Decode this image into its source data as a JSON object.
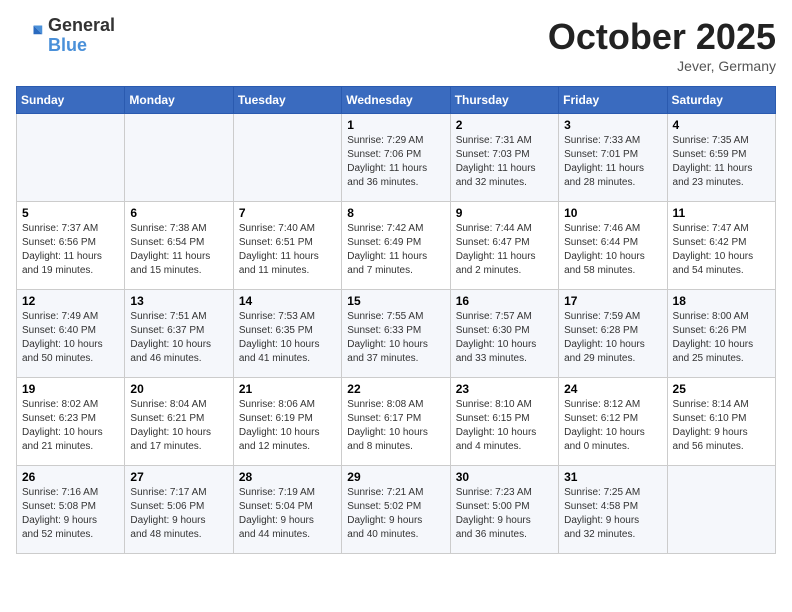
{
  "header": {
    "logo_line1": "General",
    "logo_line2": "Blue",
    "month": "October 2025",
    "location": "Jever, Germany"
  },
  "weekdays": [
    "Sunday",
    "Monday",
    "Tuesday",
    "Wednesday",
    "Thursday",
    "Friday",
    "Saturday"
  ],
  "weeks": [
    [
      {
        "day": "",
        "info": ""
      },
      {
        "day": "",
        "info": ""
      },
      {
        "day": "",
        "info": ""
      },
      {
        "day": "1",
        "info": "Sunrise: 7:29 AM\nSunset: 7:06 PM\nDaylight: 11 hours\nand 36 minutes."
      },
      {
        "day": "2",
        "info": "Sunrise: 7:31 AM\nSunset: 7:03 PM\nDaylight: 11 hours\nand 32 minutes."
      },
      {
        "day": "3",
        "info": "Sunrise: 7:33 AM\nSunset: 7:01 PM\nDaylight: 11 hours\nand 28 minutes."
      },
      {
        "day": "4",
        "info": "Sunrise: 7:35 AM\nSunset: 6:59 PM\nDaylight: 11 hours\nand 23 minutes."
      }
    ],
    [
      {
        "day": "5",
        "info": "Sunrise: 7:37 AM\nSunset: 6:56 PM\nDaylight: 11 hours\nand 19 minutes."
      },
      {
        "day": "6",
        "info": "Sunrise: 7:38 AM\nSunset: 6:54 PM\nDaylight: 11 hours\nand 15 minutes."
      },
      {
        "day": "7",
        "info": "Sunrise: 7:40 AM\nSunset: 6:51 PM\nDaylight: 11 hours\nand 11 minutes."
      },
      {
        "day": "8",
        "info": "Sunrise: 7:42 AM\nSunset: 6:49 PM\nDaylight: 11 hours\nand 7 minutes."
      },
      {
        "day": "9",
        "info": "Sunrise: 7:44 AM\nSunset: 6:47 PM\nDaylight: 11 hours\nand 2 minutes."
      },
      {
        "day": "10",
        "info": "Sunrise: 7:46 AM\nSunset: 6:44 PM\nDaylight: 10 hours\nand 58 minutes."
      },
      {
        "day": "11",
        "info": "Sunrise: 7:47 AM\nSunset: 6:42 PM\nDaylight: 10 hours\nand 54 minutes."
      }
    ],
    [
      {
        "day": "12",
        "info": "Sunrise: 7:49 AM\nSunset: 6:40 PM\nDaylight: 10 hours\nand 50 minutes."
      },
      {
        "day": "13",
        "info": "Sunrise: 7:51 AM\nSunset: 6:37 PM\nDaylight: 10 hours\nand 46 minutes."
      },
      {
        "day": "14",
        "info": "Sunrise: 7:53 AM\nSunset: 6:35 PM\nDaylight: 10 hours\nand 41 minutes."
      },
      {
        "day": "15",
        "info": "Sunrise: 7:55 AM\nSunset: 6:33 PM\nDaylight: 10 hours\nand 37 minutes."
      },
      {
        "day": "16",
        "info": "Sunrise: 7:57 AM\nSunset: 6:30 PM\nDaylight: 10 hours\nand 33 minutes."
      },
      {
        "day": "17",
        "info": "Sunrise: 7:59 AM\nSunset: 6:28 PM\nDaylight: 10 hours\nand 29 minutes."
      },
      {
        "day": "18",
        "info": "Sunrise: 8:00 AM\nSunset: 6:26 PM\nDaylight: 10 hours\nand 25 minutes."
      }
    ],
    [
      {
        "day": "19",
        "info": "Sunrise: 8:02 AM\nSunset: 6:23 PM\nDaylight: 10 hours\nand 21 minutes."
      },
      {
        "day": "20",
        "info": "Sunrise: 8:04 AM\nSunset: 6:21 PM\nDaylight: 10 hours\nand 17 minutes."
      },
      {
        "day": "21",
        "info": "Sunrise: 8:06 AM\nSunset: 6:19 PM\nDaylight: 10 hours\nand 12 minutes."
      },
      {
        "day": "22",
        "info": "Sunrise: 8:08 AM\nSunset: 6:17 PM\nDaylight: 10 hours\nand 8 minutes."
      },
      {
        "day": "23",
        "info": "Sunrise: 8:10 AM\nSunset: 6:15 PM\nDaylight: 10 hours\nand 4 minutes."
      },
      {
        "day": "24",
        "info": "Sunrise: 8:12 AM\nSunset: 6:12 PM\nDaylight: 10 hours\nand 0 minutes."
      },
      {
        "day": "25",
        "info": "Sunrise: 8:14 AM\nSunset: 6:10 PM\nDaylight: 9 hours\nand 56 minutes."
      }
    ],
    [
      {
        "day": "26",
        "info": "Sunrise: 7:16 AM\nSunset: 5:08 PM\nDaylight: 9 hours\nand 52 minutes."
      },
      {
        "day": "27",
        "info": "Sunrise: 7:17 AM\nSunset: 5:06 PM\nDaylight: 9 hours\nand 48 minutes."
      },
      {
        "day": "28",
        "info": "Sunrise: 7:19 AM\nSunset: 5:04 PM\nDaylight: 9 hours\nand 44 minutes."
      },
      {
        "day": "29",
        "info": "Sunrise: 7:21 AM\nSunset: 5:02 PM\nDaylight: 9 hours\nand 40 minutes."
      },
      {
        "day": "30",
        "info": "Sunrise: 7:23 AM\nSunset: 5:00 PM\nDaylight: 9 hours\nand 36 minutes."
      },
      {
        "day": "31",
        "info": "Sunrise: 7:25 AM\nSunset: 4:58 PM\nDaylight: 9 hours\nand 32 minutes."
      },
      {
        "day": "",
        "info": ""
      }
    ]
  ]
}
